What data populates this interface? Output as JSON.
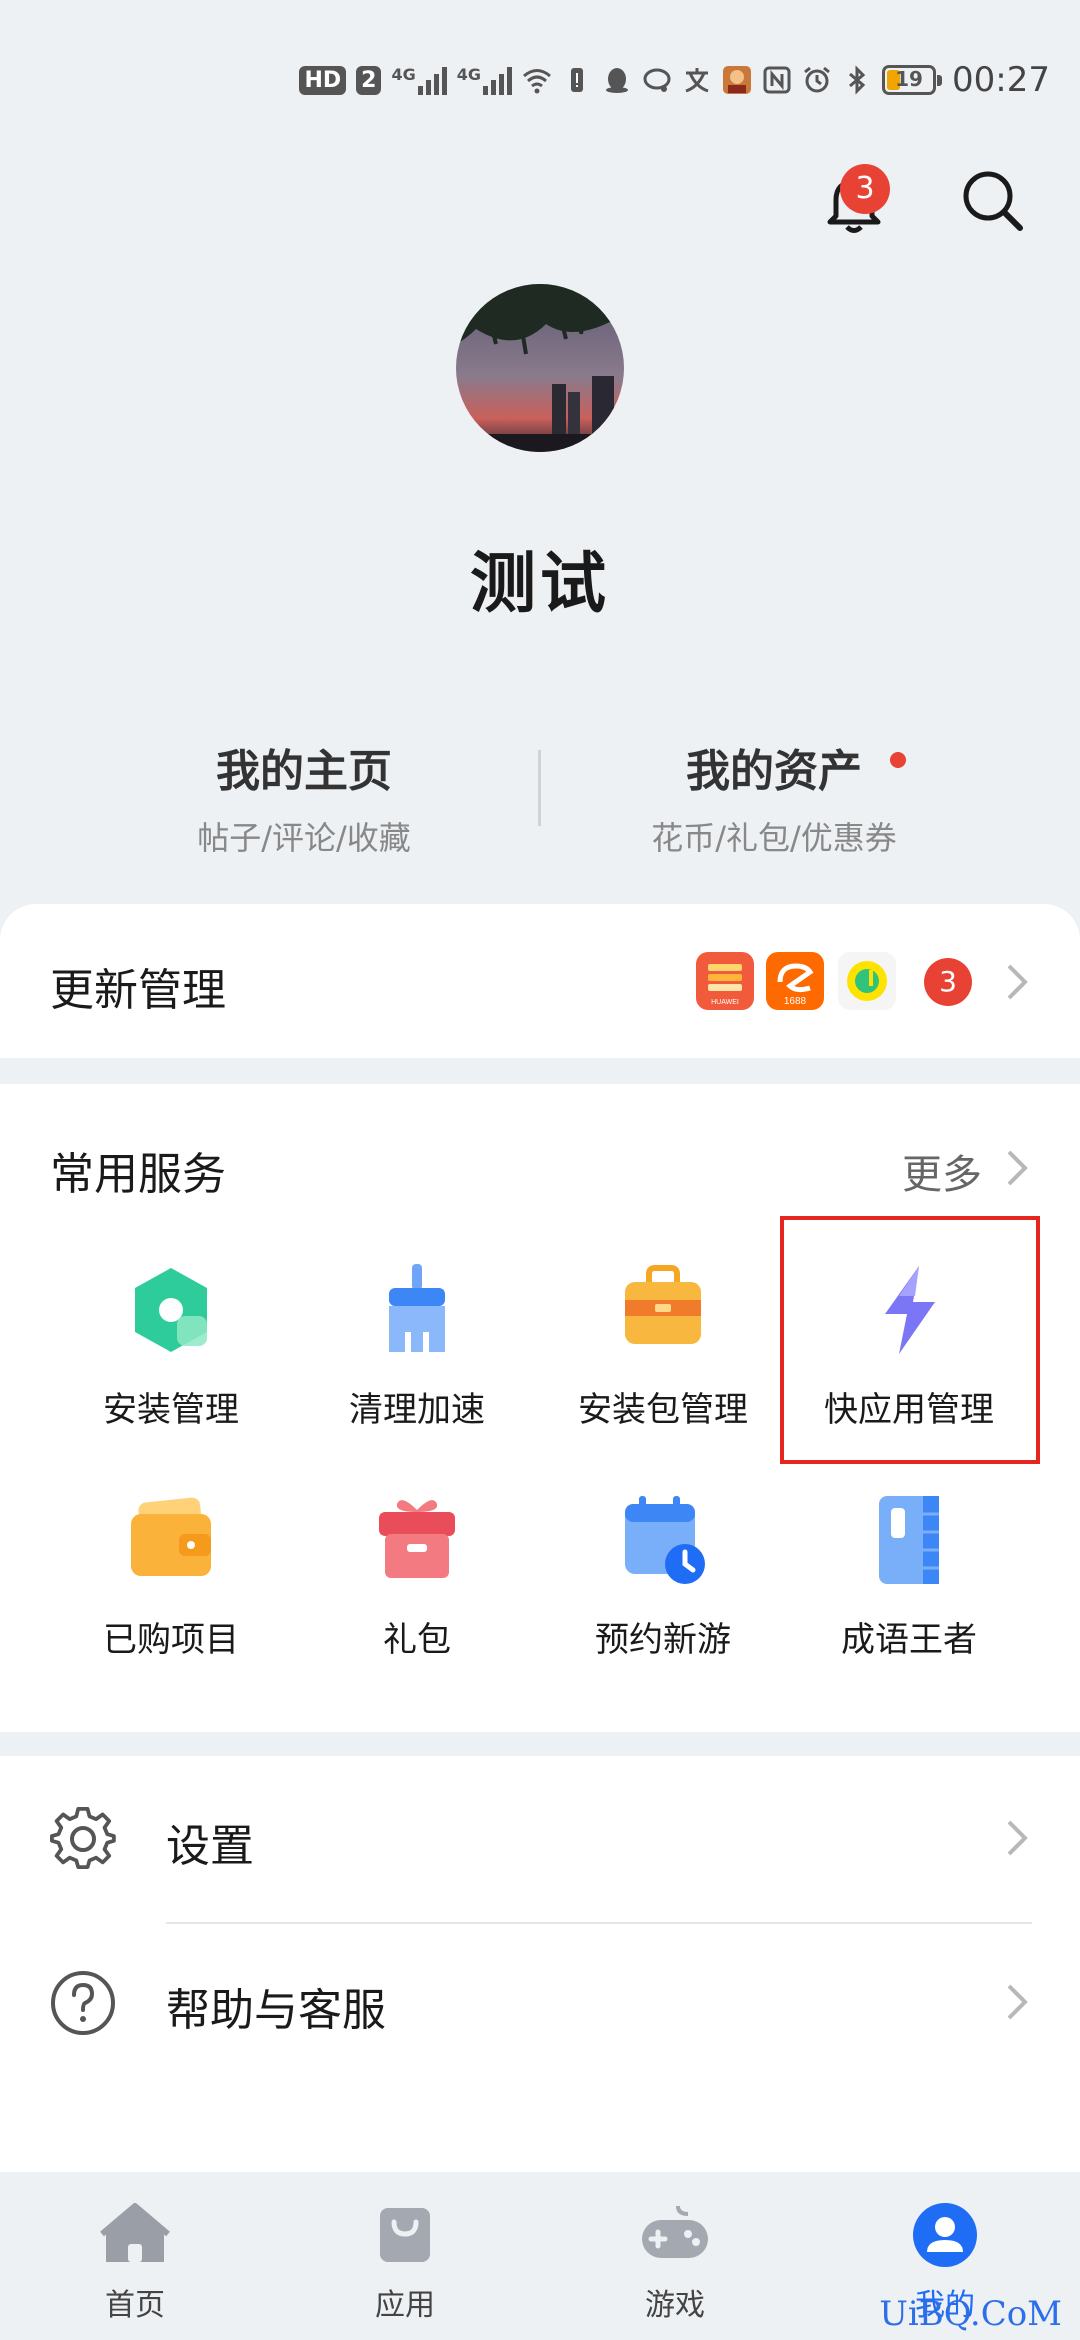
{
  "status_bar": {
    "hd_label": "HD",
    "sim_label": "2",
    "network_1": "4G",
    "network_2": "4G",
    "battery_level": "19",
    "time": "00:27"
  },
  "header": {
    "notification_count": "3"
  },
  "profile": {
    "username": "测试",
    "my_page_title": "我的主页",
    "my_page_sub": "帖子/评论/收藏",
    "assets_title": "我的资产",
    "assets_sub": "花币/礼包/优惠券"
  },
  "updates": {
    "label": "更新管理",
    "count": "3",
    "app_icons": [
      "huawei-video-icon",
      "alibaba-1688-icon",
      "qq-music-icon"
    ],
    "icon_text_1": "HUAWEI",
    "icon_text_2": "1688"
  },
  "services": {
    "title": "常用服务",
    "more_label": "更多",
    "items": [
      {
        "label": "安装管理",
        "icon": "install-manage-icon"
      },
      {
        "label": "清理加速",
        "icon": "clean-boost-icon"
      },
      {
        "label": "安装包管理",
        "icon": "package-manage-icon"
      },
      {
        "label": "快应用管理",
        "icon": "quick-app-icon"
      },
      {
        "label": "已购项目",
        "icon": "wallet-icon"
      },
      {
        "label": "礼包",
        "icon": "gift-icon"
      },
      {
        "label": "预约新游",
        "icon": "calendar-icon"
      },
      {
        "label": "成语王者",
        "icon": "book-icon"
      }
    ]
  },
  "settings": {
    "settings_label": "设置",
    "help_label": "帮助与客服"
  },
  "bottom_nav": {
    "items": [
      "首页",
      "应用",
      "游戏",
      "我的"
    ],
    "active": "我的"
  },
  "watermark": "UiBQ.CoM",
  "colors": {
    "background": "#eef1f4",
    "badge_red": "#e84235",
    "highlight_box": "#e5261f",
    "active_blue": "#1f6cf5"
  }
}
